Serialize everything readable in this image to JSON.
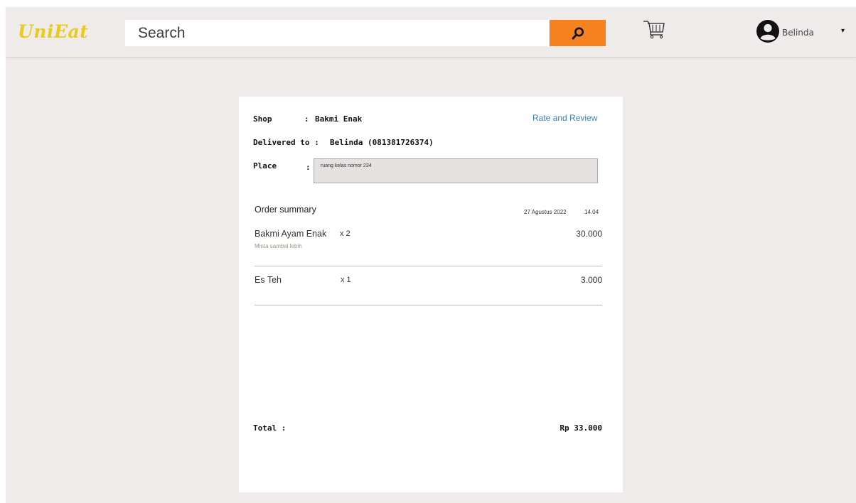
{
  "header": {
    "logo": "UniEat",
    "search_placeholder": "Search",
    "user_name": "Belinda",
    "dropdown_glyph": "▾",
    "icons": {
      "search": "search-icon",
      "cart": "cart-icon",
      "avatar": "user-avatar-icon"
    },
    "colors": {
      "logo": "#e8cc1c",
      "search_button": "#f5821f",
      "background": "#efebea"
    }
  },
  "order": {
    "shop_label": "Shop",
    "shop_separator": ":",
    "shop_value": "Bakmi Enak",
    "delivered_label": "Delivered to :",
    "delivered_value": "Belinda  (081381726374)",
    "place_label": "Place",
    "place_separator": ":",
    "place_value": "ruang kelas nomor 234",
    "rate_review": "Rate and Review",
    "colors": {
      "link": "#3f7fbf"
    }
  },
  "summary": {
    "title": "Order summary",
    "date": "27 Agustus 2022",
    "time": "14.04",
    "items": [
      {
        "name": "Bakmi Ayam Enak",
        "qty": "x 2",
        "price": "30.000",
        "note": "Minta sambal lebih"
      },
      {
        "name": "Es Teh",
        "qty": "x 1",
        "price": "3.000",
        "note": ""
      }
    ],
    "total_label": "Total :",
    "total_value": "Rp 33.000"
  }
}
